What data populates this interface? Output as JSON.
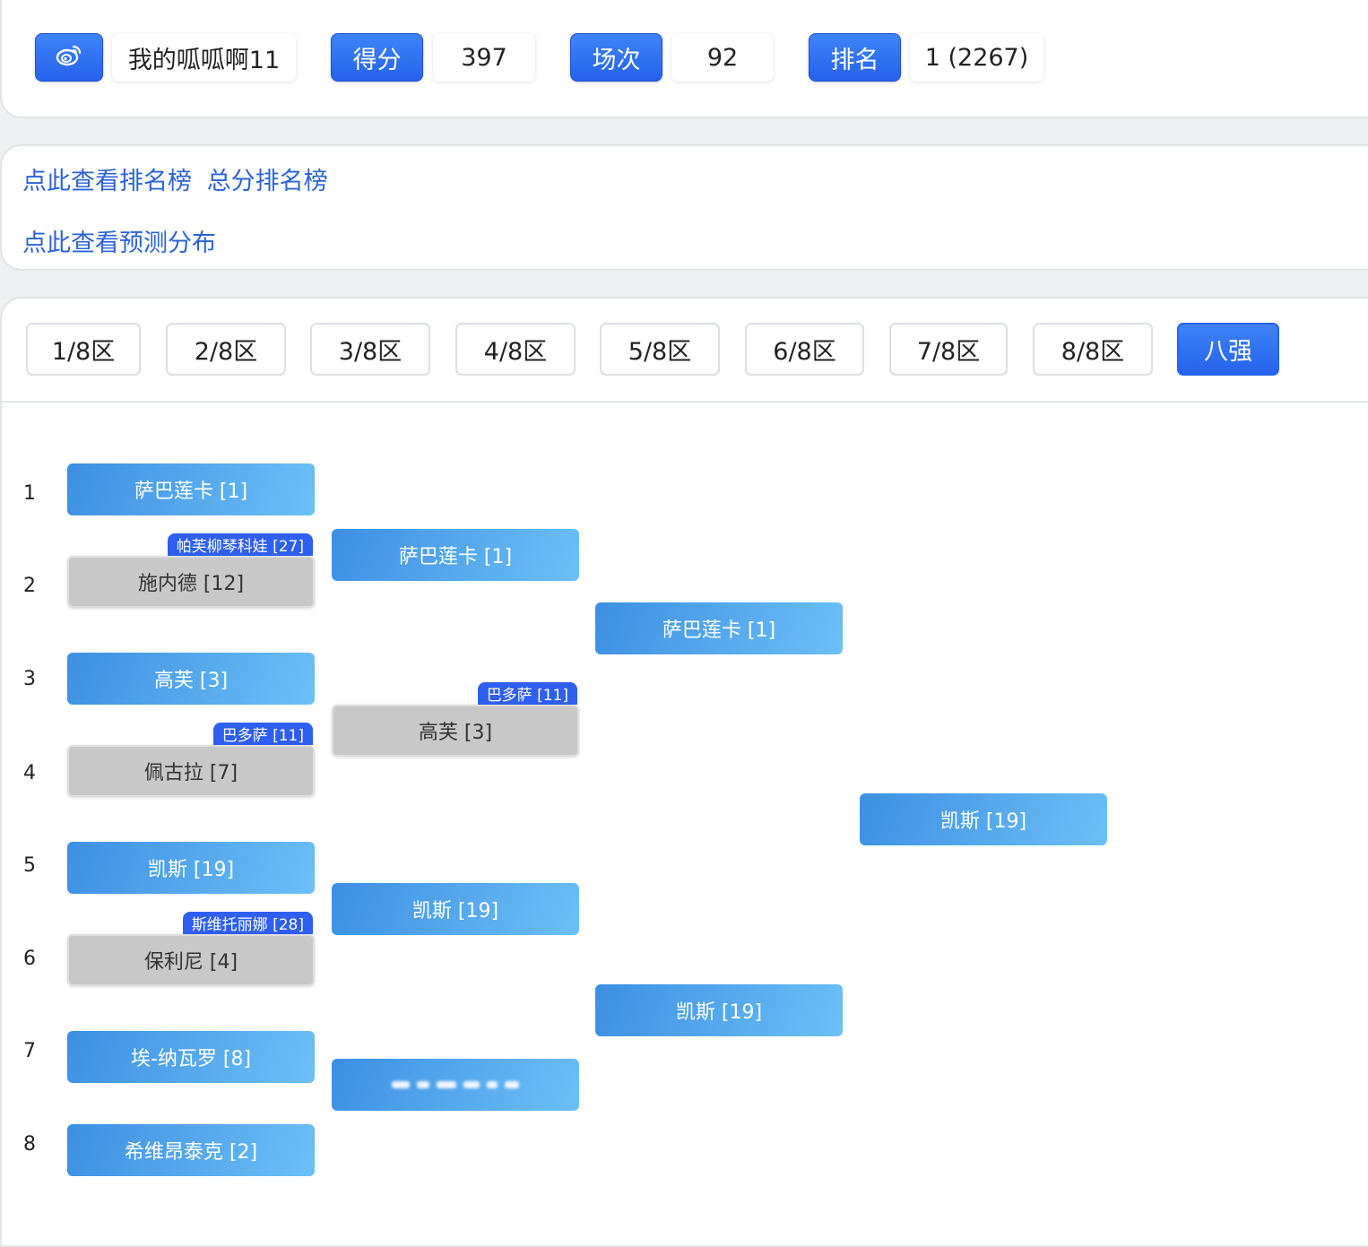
{
  "header": {
    "weibo_icon": "weibo-icon",
    "username": "我的呱呱啊11",
    "score_label": "得分",
    "score_value": "397",
    "matches_label": "场次",
    "matches_value": "92",
    "rank_label": "排名",
    "rank_value": "1 (2267)"
  },
  "links": {
    "rankings": "点此查看排名榜",
    "total_rankings": "总分排名榜",
    "prediction": "点此查看预测分布"
  },
  "tabs": [
    "1/8区",
    "2/8区",
    "3/8区",
    "4/8区",
    "5/8区",
    "6/8区",
    "7/8区",
    "8/8区",
    "八强"
  ],
  "active_tab": "八强",
  "bracket": {
    "seeds": [
      "1",
      "2",
      "3",
      "4",
      "5",
      "6",
      "7",
      "8"
    ],
    "round1": [
      {
        "name": "萨巴莲卡 [1]",
        "status": "win"
      },
      {
        "name": "施内德 [12]",
        "status": "lose",
        "tag": "帕芙柳琴科娃 [27]"
      },
      {
        "name": "高芙 [3]",
        "status": "win"
      },
      {
        "name": "佩古拉 [7]",
        "status": "lose",
        "tag": "巴多萨 [11]"
      },
      {
        "name": "凯斯 [19]",
        "status": "win"
      },
      {
        "name": "保利尼 [4]",
        "status": "lose",
        "tag": "斯维托丽娜 [28]"
      },
      {
        "name": "埃-纳瓦罗 [8]",
        "status": "win"
      },
      {
        "name": "希维昂泰克 [2]",
        "status": "win"
      }
    ],
    "round2": [
      {
        "name": "萨巴莲卡 [1]",
        "status": "win"
      },
      {
        "name": "高芙 [3]",
        "status": "lose",
        "tag": "巴多萨 [11]"
      },
      {
        "name": "凯斯 [19]",
        "status": "win"
      },
      {
        "name": "",
        "status": "win"
      }
    ],
    "round3": [
      {
        "name": "萨巴莲卡 [1]",
        "status": "win"
      },
      {
        "name": "凯斯 [19]",
        "status": "win"
      }
    ],
    "final": {
      "name": "凯斯 [19]",
      "status": "win"
    }
  },
  "colors": {
    "primary": "#2563eb",
    "link": "#2c63d6",
    "winner_gradient_start": "#3d8fe3",
    "winner_gradient_end": "#6cc0f6",
    "loser_bg": "#c8c8c8",
    "tag_bg": "#2f5ff0"
  }
}
